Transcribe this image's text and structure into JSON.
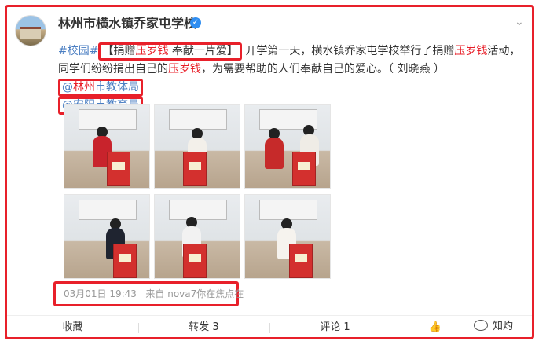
{
  "post": {
    "author": "林州市横水镇乔家屯学校",
    "hashtag": "#校园#",
    "title_open": "【捐赠",
    "title_red": "压岁钱",
    "title_rest": " 奉献一片爱】",
    "text_1": " 开学第一天，横水镇乔家屯学校举行了捐赠",
    "text_red_1": "压岁钱",
    "text_2": "活动，同学们纷纷捐出自己的",
    "text_red_2": "压岁钱",
    "text_3": "，为需要帮助的人们奉献自己的爱心。（ 刘晓燕 ）",
    "mention_1_prefix": "@",
    "mention_1_a": "林州",
    "mention_1_b": "市教体局",
    "mention_2": "@安阳市教育局",
    "box_label": "捐款箱",
    "timestamp": "03月01日 19:43",
    "source_prefix": "来自",
    "source_device": "nova7你在焦点在"
  },
  "actions": {
    "favorite": "收藏",
    "repost": "转发 3",
    "comment": "评论 1",
    "like_icon": "thumbs-up-icon"
  },
  "watermark": {
    "text": "知灼"
  },
  "colors": {
    "highlight_red": "#e8202a",
    "link_blue": "#4a7ec2",
    "verify_blue": "#2f8df0"
  }
}
